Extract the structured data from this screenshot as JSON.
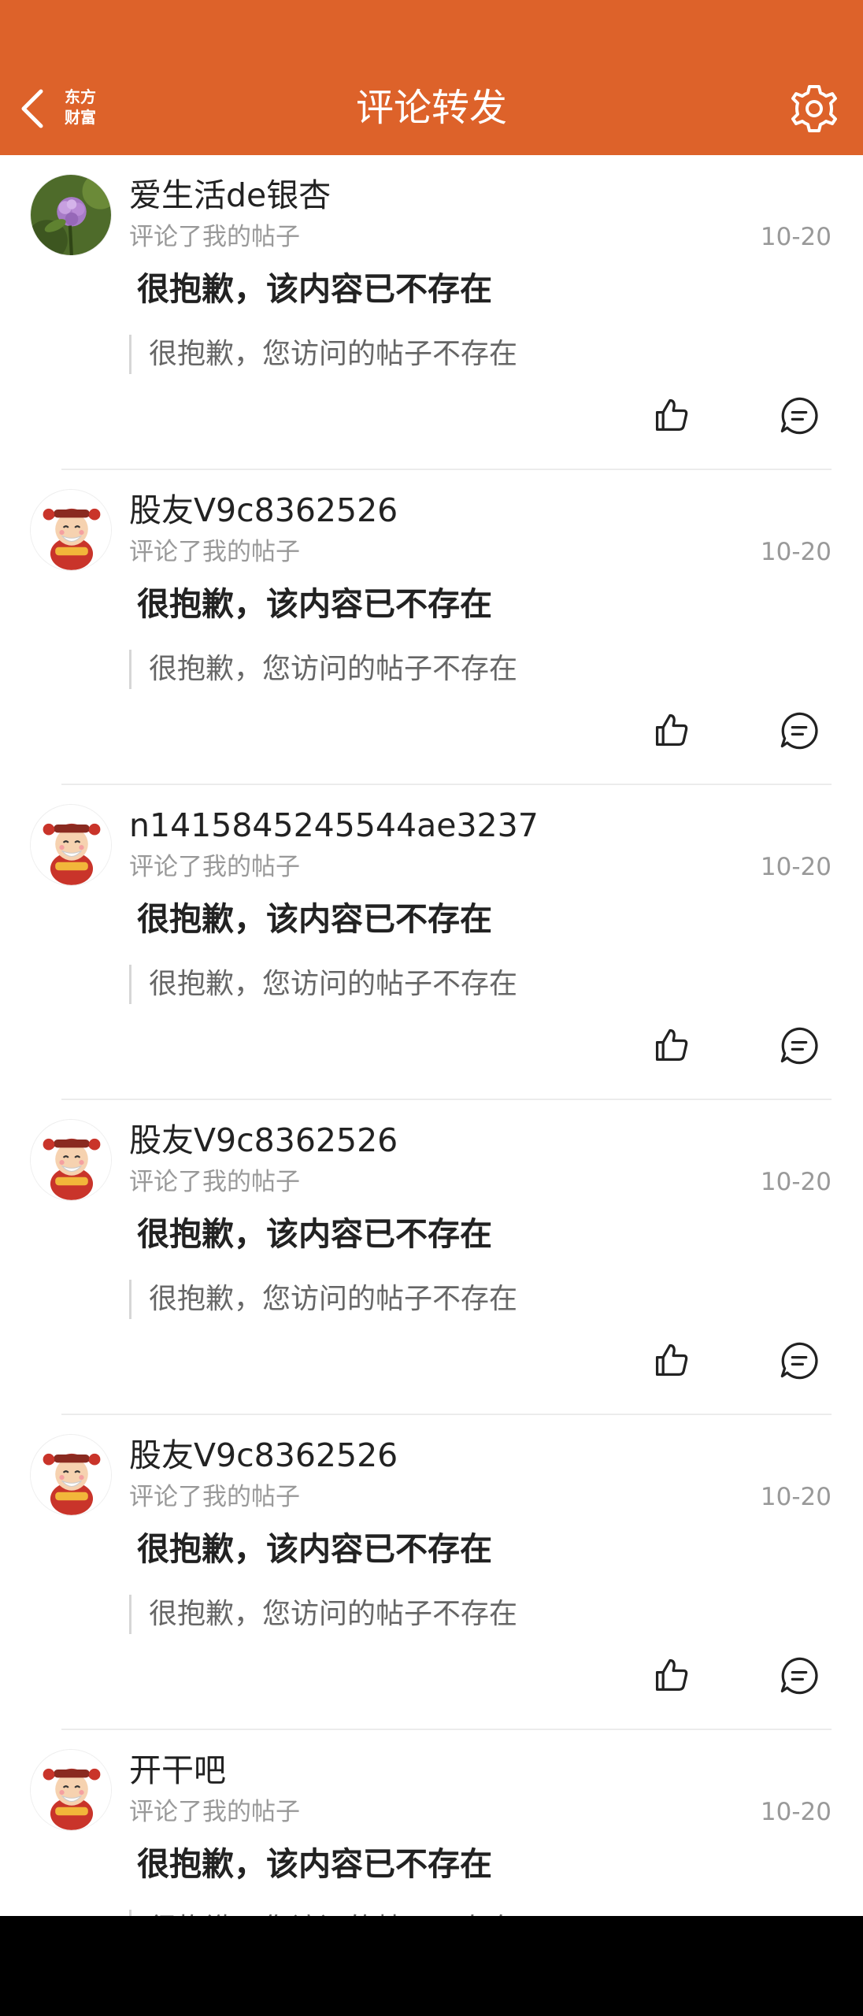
{
  "header": {
    "title": "评论转发",
    "logo_line1": "东方",
    "logo_line2": "财富",
    "back_icon": "chevron-left-icon",
    "settings_icon": "gear-icon",
    "background_color": "#dd622a"
  },
  "items": [
    {
      "username": "爱生活de银杏",
      "action": "评论了我的帖子",
      "date": "10-20",
      "comment": "很抱歉，该内容已不存在",
      "quote": "很抱歉，您访问的帖子不存在",
      "avatar": "flower-photo"
    },
    {
      "username": "股友V9c8362526",
      "action": "评论了我的帖子",
      "date": "10-20",
      "comment": "很抱歉，该内容已不存在",
      "quote": "很抱歉，您访问的帖子不存在",
      "avatar": "fortune-god-avatar"
    },
    {
      "username": "n1415845245544ae3237",
      "action": "评论了我的帖子",
      "date": "10-20",
      "comment": "很抱歉，该内容已不存在",
      "quote": "很抱歉，您访问的帖子不存在",
      "avatar": "fortune-god-avatar"
    },
    {
      "username": "股友V9c8362526",
      "action": "评论了我的帖子",
      "date": "10-20",
      "comment": "很抱歉，该内容已不存在",
      "quote": "很抱歉，您访问的帖子不存在",
      "avatar": "fortune-god-avatar"
    },
    {
      "username": "股友V9c8362526",
      "action": "评论了我的帖子",
      "date": "10-20",
      "comment": "很抱歉，该内容已不存在",
      "quote": "很抱歉，您访问的帖子不存在",
      "avatar": "fortune-god-avatar"
    },
    {
      "username": "开干吧",
      "action": "评论了我的帖子",
      "date": "10-20",
      "comment": "很抱歉，该内容已不存在",
      "quote": "很抱歉，您访问的帖子不存在",
      "avatar": "fortune-god-avatar"
    }
  ],
  "icons": {
    "like": "thumbs-up-icon",
    "reply": "comment-icon"
  }
}
